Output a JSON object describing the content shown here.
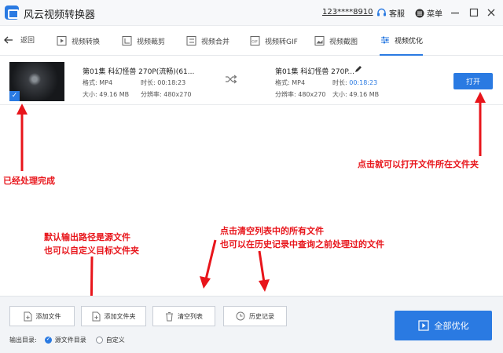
{
  "app": {
    "title": "风云视频转换器",
    "user": "123****8910",
    "support": "客服",
    "menu": "菜单"
  },
  "nav": {
    "back": "返回",
    "tabs": [
      "视频转换",
      "视频裁剪",
      "视频合并",
      "视频转GIF",
      "视频截图",
      "视频优化"
    ]
  },
  "file": {
    "source": {
      "name": "第01集 科幻怪兽 270P(流畅)(61...",
      "format_label": "格式:",
      "format": "MP4",
      "duration_label": "时长:",
      "duration": "00:18:23",
      "size_label": "大小:",
      "size": "49.16 MB",
      "resolution_label": "分辨率:",
      "resolution": "480x270"
    },
    "output": {
      "name": "第01集 科幻怪兽 270P...",
      "format_label": "格式:",
      "format": "MP4",
      "duration_label": "时长:",
      "duration": "00:18:23",
      "resolution_label": "分辨率:",
      "resolution": "480x270",
      "size_label": "大小:",
      "size": "49.16 MB"
    },
    "open_label": "打开"
  },
  "annotations": {
    "done": "已经处理完成",
    "open_folder": "点击就可以打开文件所在文件夹",
    "default_path_1": "默认输出路径是源文件",
    "default_path_2": "也可以自定义目标文件夹",
    "clear_1": "点击清空列表中的所有文件",
    "clear_2": "也可以在历史记录中查询之前处理过的文件"
  },
  "bottom": {
    "add_file": "添加文件",
    "add_folder": "添加文件夹",
    "clear_list": "清空列表",
    "history": "历史记录",
    "output_label": "输出目录:",
    "source_dir": "源文件目录",
    "custom": "自定义",
    "optimize_all": "全部优化"
  },
  "colors": {
    "accent": "#2a7ae2",
    "annotation": "#e8151b"
  }
}
